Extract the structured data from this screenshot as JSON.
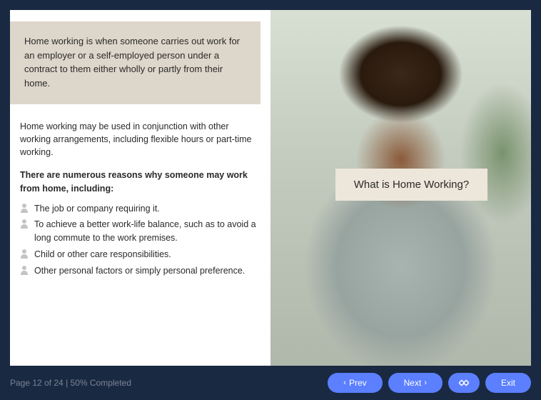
{
  "definition": "Home working is when someone carries out work for an employer or a self-employed person under a contract to them either wholly or partly from their home.",
  "intro_text": "Home working may be used in conjunction with other working arrangements, including flexible hours or part-time working.",
  "intro_heading": "There are numerous reasons why someone may work from home, including:",
  "reasons": [
    "The job or company requiring it.",
    "To achieve a better work-life balance, such as to avoid a long commute to the work premises.",
    "Child or other care responsibilities.",
    "Other personal factors or simply personal preference."
  ],
  "overlay_title": "What is Home Working?",
  "footer": {
    "page_info": "Page 12 of 24 | 50% Completed",
    "prev_label": "Prev",
    "next_label": "Next",
    "exit_label": "Exit"
  }
}
